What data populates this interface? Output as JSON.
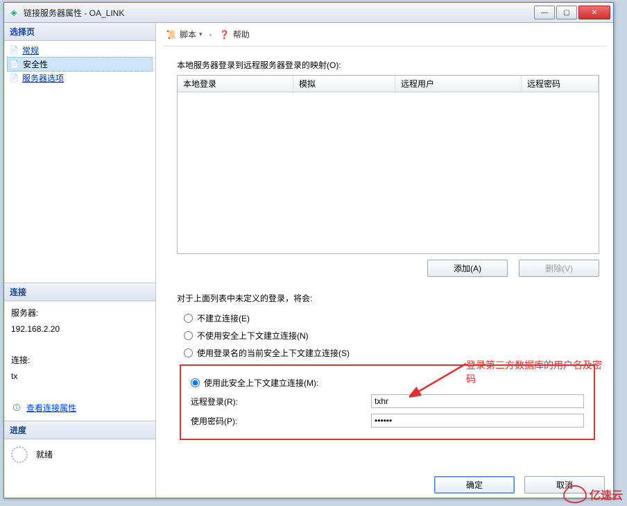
{
  "window": {
    "title": "链接服务器属性 - OA_LINK"
  },
  "sidebar": {
    "header": "选择页",
    "items": [
      {
        "label": "常规"
      },
      {
        "label": "安全性"
      },
      {
        "label": "服务器选项"
      }
    ],
    "selected_index": 1
  },
  "connection": {
    "header": "连接",
    "server_label": "服务器:",
    "server_value": "192.168.2.20",
    "conn_label": "连接:",
    "conn_value": "tx",
    "view_link": "查看连接属性"
  },
  "progress": {
    "header": "进度",
    "status": "就绪"
  },
  "toolbar": {
    "script": "脚本",
    "help": "帮助",
    "dropdown_glyph": "▾",
    "sep": "▪"
  },
  "mapping": {
    "caption": "本地服务器登录到远程服务器登录的映射(O):",
    "columns": [
      "本地登录",
      "模拟",
      "远程用户",
      "远程密码"
    ],
    "rows": []
  },
  "buttons": {
    "add": "添加(A)",
    "delete": "删除(V)",
    "ok": "确定",
    "cancel": "取消"
  },
  "undef": {
    "caption": "对于上面列表中未定义的登录，将会:",
    "options": [
      "不建立连接(E)",
      "不使用安全上下文建立连接(N)",
      "使用登录名的当前安全上下文建立连接(S)",
      "使用此安全上下文建立连接(M):"
    ],
    "selected_index": 3
  },
  "creds": {
    "remote_login_label": "远程登录(R):",
    "remote_login_value": "txhr",
    "password_label": "使用密码(P):",
    "password_value": "******"
  },
  "annotation": {
    "text_l1": "登录第三方数据库的用户名及密",
    "text_l2": "码"
  },
  "watermark": {
    "text": "亿速云"
  }
}
